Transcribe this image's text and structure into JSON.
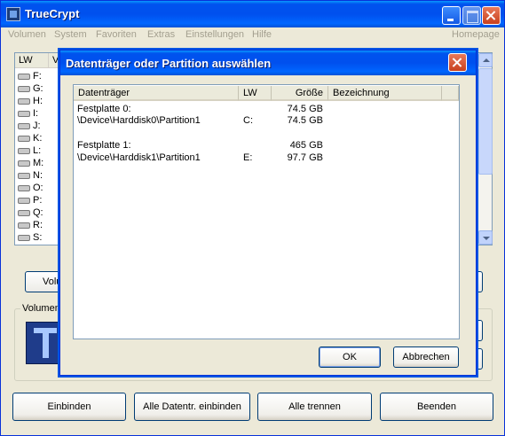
{
  "app": {
    "title": "TrueCrypt",
    "menu": [
      "Volumen",
      "System",
      "Favoriten",
      "Extras",
      "Einstellungen",
      "Hilfe"
    ],
    "homepage": "Homepage"
  },
  "drive_list": {
    "columns": [
      "LW",
      "V"
    ],
    "drives": [
      "F:",
      "G:",
      "H:",
      "I:",
      "J:",
      "K:",
      "L:",
      "M:",
      "N:",
      "O:",
      "P:",
      "Q:",
      "R:",
      "S:"
    ]
  },
  "volume_group": {
    "label": "Volumen",
    "button_partial": "Volu"
  },
  "bottom_buttons": {
    "mount": "Einbinden",
    "mount_all": "Alle Datentr. einbinden",
    "dismount_all": "Alle trennen",
    "exit": "Beenden"
  },
  "dialog": {
    "title": "Datenträger oder Partition auswählen",
    "columns": [
      "Datenträger",
      "LW",
      "Größe",
      "Bezeichnung"
    ],
    "rows": [
      {
        "device": "Festplatte 0:",
        "drive": "",
        "size": "74.5 GB",
        "label": ""
      },
      {
        "device": "\\Device\\Harddisk0\\Partition1",
        "drive": "C:",
        "size": "74.5 GB",
        "label": ""
      },
      {
        "device": "Festplatte 1:",
        "drive": "",
        "size": "465 GB",
        "label": ""
      },
      {
        "device": "\\Device\\Harddisk1\\Partition1",
        "drive": "E:",
        "size": "97.7 GB",
        "label": ""
      }
    ],
    "ok": "OK",
    "cancel": "Abbrechen"
  }
}
